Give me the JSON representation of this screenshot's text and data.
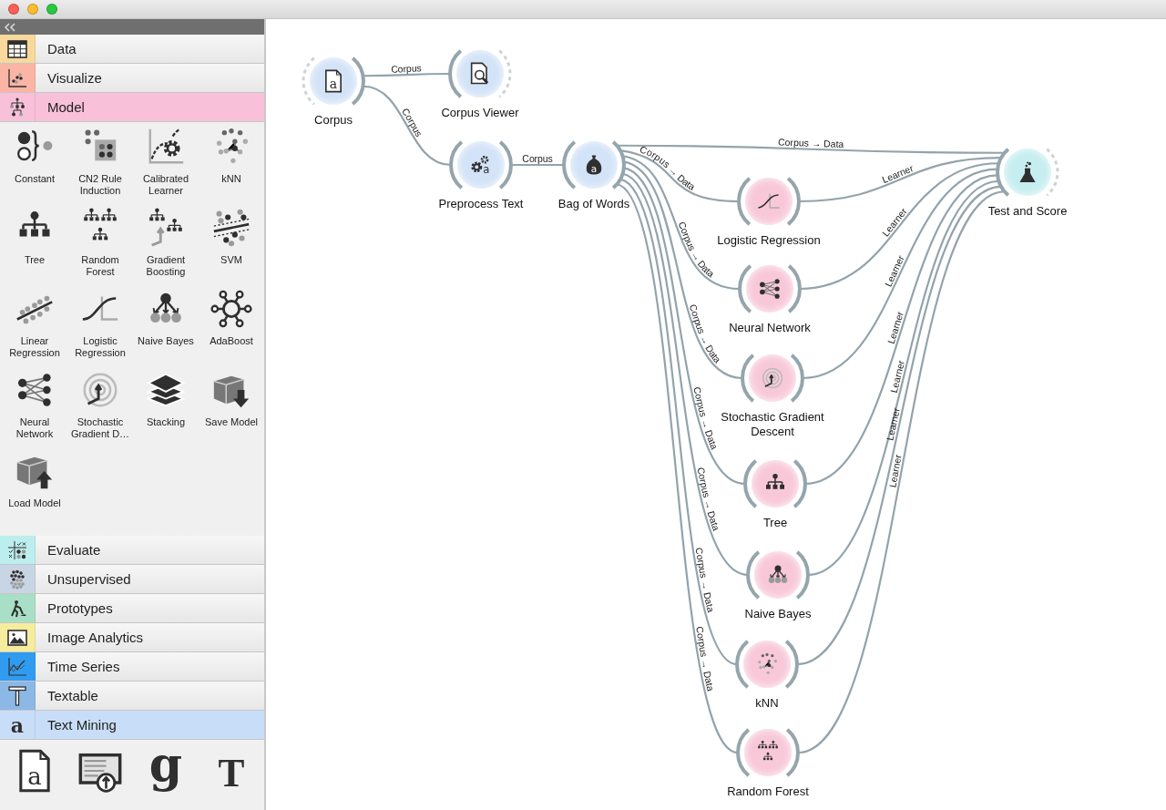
{
  "toolbox": {
    "categories": [
      {
        "label": "Data",
        "kind": "data",
        "color": "#f9d89c",
        "expanded": false
      },
      {
        "label": "Visualize",
        "kind": "visualize",
        "color": "#fbb5a5",
        "expanded": false
      },
      {
        "label": "Model",
        "kind": "model",
        "color": "#f8c1d9",
        "expanded": true,
        "widgets": [
          {
            "label": "Constant",
            "kind": "constant"
          },
          {
            "label": "CN2 Rule Induction",
            "kind": "cn2"
          },
          {
            "label": "Calibrated Learner",
            "kind": "calibrated"
          },
          {
            "label": "kNN",
            "kind": "knn"
          },
          {
            "label": "Tree",
            "kind": "tree"
          },
          {
            "label": "Random Forest",
            "kind": "forest"
          },
          {
            "label": "Gradient Boosting",
            "kind": "boosting"
          },
          {
            "label": "SVM",
            "kind": "svm"
          },
          {
            "label": "Linear Regression",
            "kind": "linreg"
          },
          {
            "label": "Logistic Regression",
            "kind": "logistic"
          },
          {
            "label": "Naive Bayes",
            "kind": "bayes"
          },
          {
            "label": "AdaBoost",
            "kind": "adaboost"
          },
          {
            "label": "Neural Network",
            "kind": "neural"
          },
          {
            "label": "Stochastic Gradient D…",
            "kind": "sgd"
          },
          {
            "label": "Stacking",
            "kind": "stacking"
          },
          {
            "label": "Save Model",
            "kind": "save"
          },
          {
            "label": "Load Model",
            "kind": "load"
          }
        ]
      },
      {
        "label": "Evaluate",
        "kind": "evaluate",
        "color": "#bdeeee",
        "expanded": false
      },
      {
        "label": "Unsupervised",
        "kind": "unsupervised",
        "color": "#c8d5e5",
        "expanded": false
      },
      {
        "label": "Prototypes",
        "kind": "prototypes",
        "color": "#a9dfc6",
        "expanded": false
      },
      {
        "label": "Image Analytics",
        "kind": "image",
        "color": "#f5ec9e",
        "expanded": false
      },
      {
        "label": "Time Series",
        "kind": "timeseries",
        "color": "#2f9cf2",
        "expanded": false
      },
      {
        "label": "Textable",
        "kind": "textable",
        "color": "#8cb8e6",
        "expanded": false
      },
      {
        "label": "Text Mining",
        "kind": "textmining",
        "glyph": "a",
        "color": "#c8def8",
        "expanded": true,
        "widgets": [
          {
            "kind": "corpus",
            "glyph": "a"
          },
          {
            "kind": "import"
          },
          {
            "kind": "guardian",
            "glyph": "g"
          },
          {
            "kind": "nyt",
            "glyph": "T"
          }
        ]
      }
    ]
  },
  "canvas": {
    "nodes": [
      {
        "label": "Corpus",
        "kind": "corpus",
        "glyph": "a",
        "color": "#d3e3f8"
      },
      {
        "label": "Corpus Viewer",
        "kind": "viewer",
        "color": "#d3e3f8"
      },
      {
        "label": "Preprocess Text",
        "kind": "preprocess",
        "glyph": "a",
        "color": "#d3e3f8"
      },
      {
        "label": "Bag of Words",
        "kind": "bag",
        "glyph": "a",
        "color": "#d3e3f8"
      },
      {
        "label": "Test and Score",
        "kind": "flask",
        "color": "#c6eef0"
      },
      {
        "label": "Logistic Regression",
        "kind": "logistic",
        "color": "#f8c8d9"
      },
      {
        "label": "Neural Network",
        "kind": "neural",
        "color": "#f8c8d9"
      },
      {
        "label": "Stochastic Gradient Descent",
        "kind": "sgd",
        "color": "#f8c8d9"
      },
      {
        "label": "Tree",
        "kind": "tree",
        "color": "#f8c8d9"
      },
      {
        "label": "Naive Bayes",
        "kind": "bayes",
        "color": "#f8c8d9"
      },
      {
        "label": "kNN",
        "kind": "knn",
        "color": "#f8c8d9"
      },
      {
        "label": "Random Forest",
        "kind": "forest",
        "color": "#f8c8d9"
      }
    ],
    "links": [
      {
        "label": "Corpus"
      },
      {
        "label": "Corpus"
      },
      {
        "label": "Corpus"
      },
      {
        "label": "Corpus → Data"
      },
      {
        "label": "Corpus → Data"
      },
      {
        "label": "Corpus → Data"
      },
      {
        "label": "Corpus → Data"
      },
      {
        "label": "Corpus → Data"
      },
      {
        "label": "Corpus → Data"
      },
      {
        "label": "Corpus → Data"
      },
      {
        "label": "Corpus → Data"
      },
      {
        "label": "Learner"
      },
      {
        "label": "Learner"
      },
      {
        "label": "Learner"
      },
      {
        "label": "Learner"
      },
      {
        "label": "Learner"
      },
      {
        "label": "Learner"
      },
      {
        "label": "Learner"
      }
    ]
  }
}
